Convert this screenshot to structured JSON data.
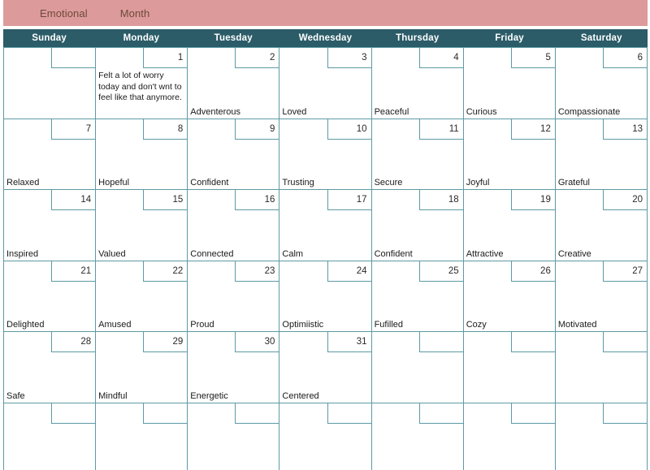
{
  "title": {
    "label": "Emotional",
    "month": "Month"
  },
  "colors": {
    "title_bar_bg": "#dd9a9a",
    "title_text": "#6b4a3a",
    "header_bg": "#2b5c68",
    "header_text": "#ffffff",
    "grid_line": "#5d9aa4",
    "cell_bg": "#ffffff",
    "body_text": "#1a1a1a"
  },
  "weekdays": [
    "Sunday",
    "Monday",
    "Tuesday",
    "Wednesday",
    "Thursday",
    "Friday",
    "Saturday"
  ],
  "weeks": [
    {
      "days": [
        {
          "date": "",
          "note": "",
          "emotion": ""
        },
        {
          "date": "1",
          "note": "Felt a lot of worry today and don't wnt to feel like that anymore.",
          "emotion": ""
        },
        {
          "date": "2",
          "note": "",
          "emotion": "Adventerous"
        },
        {
          "date": "3",
          "note": "",
          "emotion": "Loved"
        },
        {
          "date": "4",
          "note": "",
          "emotion": "Peaceful"
        },
        {
          "date": "5",
          "note": "",
          "emotion": "Curious"
        },
        {
          "date": "6",
          "note": "",
          "emotion": "Compassionate"
        }
      ]
    },
    {
      "days": [
        {
          "date": "7",
          "note": "",
          "emotion": "Relaxed"
        },
        {
          "date": "8",
          "note": "",
          "emotion": "Hopeful"
        },
        {
          "date": "9",
          "note": "",
          "emotion": "Confident"
        },
        {
          "date": "10",
          "note": "",
          "emotion": "Trusting"
        },
        {
          "date": "11",
          "note": "",
          "emotion": "Secure"
        },
        {
          "date": "12",
          "note": "",
          "emotion": "Joyful"
        },
        {
          "date": "13",
          "note": "",
          "emotion": "Grateful"
        }
      ]
    },
    {
      "days": [
        {
          "date": "14",
          "note": "",
          "emotion": "Inspired"
        },
        {
          "date": "15",
          "note": "",
          "emotion": "Valued"
        },
        {
          "date": "16",
          "note": "",
          "emotion": "Connected"
        },
        {
          "date": "17",
          "note": "",
          "emotion": "Calm"
        },
        {
          "date": "18",
          "note": "",
          "emotion": "Confident"
        },
        {
          "date": "19",
          "note": "",
          "emotion": "Attractive"
        },
        {
          "date": "20",
          "note": "",
          "emotion": "Creative"
        }
      ]
    },
    {
      "days": [
        {
          "date": "21",
          "note": "",
          "emotion": "Delighted"
        },
        {
          "date": "22",
          "note": "",
          "emotion": "Amused"
        },
        {
          "date": "23",
          "note": "",
          "emotion": "Proud"
        },
        {
          "date": "24",
          "note": "",
          "emotion": "Optimiistic"
        },
        {
          "date": "25",
          "note": "",
          "emotion": "Fufilled"
        },
        {
          "date": "26",
          "note": "",
          "emotion": "Cozy"
        },
        {
          "date": "27",
          "note": "",
          "emotion": "Motivated"
        }
      ]
    },
    {
      "days": [
        {
          "date": "28",
          "note": "",
          "emotion": "Safe"
        },
        {
          "date": "29",
          "note": "",
          "emotion": "Mindful"
        },
        {
          "date": "30",
          "note": "",
          "emotion": "Energetic"
        },
        {
          "date": "31",
          "note": "",
          "emotion": "Centered"
        },
        {
          "date": "",
          "note": "",
          "emotion": ""
        },
        {
          "date": "",
          "note": "",
          "emotion": ""
        },
        {
          "date": "",
          "note": "",
          "emotion": ""
        }
      ]
    },
    {
      "days": [
        {
          "date": "",
          "note": "",
          "emotion": ""
        },
        {
          "date": "",
          "note": "",
          "emotion": ""
        },
        {
          "date": "",
          "note": "",
          "emotion": ""
        },
        {
          "date": "",
          "note": "",
          "emotion": ""
        },
        {
          "date": "",
          "note": "",
          "emotion": ""
        },
        {
          "date": "",
          "note": "",
          "emotion": ""
        },
        {
          "date": "",
          "note": "",
          "emotion": ""
        }
      ]
    }
  ]
}
